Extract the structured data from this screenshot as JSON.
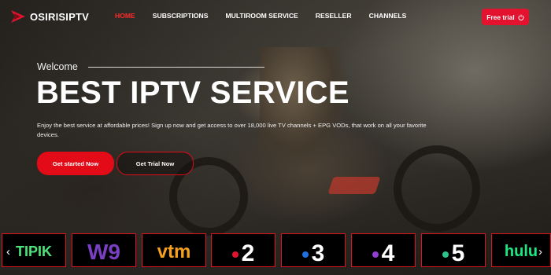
{
  "header": {
    "logo_text": "OSIRISIPTV",
    "nav": [
      {
        "label": "HOME",
        "active": true
      },
      {
        "label": "SUBSCRIPTIONS",
        "active": false
      },
      {
        "label": "MULTIROOM SERVICE",
        "active": false
      },
      {
        "label": "RESELLER",
        "active": false
      },
      {
        "label": "CHANNELS",
        "active": false
      }
    ],
    "cta_label": "Free trial",
    "cta_icon": "power-icon"
  },
  "hero": {
    "welcome": "Welcome",
    "title": "BEST IPTV SERVICE",
    "description": "Enjoy the best service at affordable prices! Sign up now and get access to over 18,000 live TV channels + EPG VODs, that work on all your favorite devices.",
    "primary_button": "Get started Now",
    "secondary_button": "Get Trial Now"
  },
  "channels": {
    "prev_icon": "chevron-left-icon",
    "next_icon": "chevron-right-icon",
    "items": [
      {
        "name": "tipik",
        "label": "TIPIK",
        "color": "#4be37a"
      },
      {
        "name": "w9",
        "label": "W9",
        "color": "#7b3fc4"
      },
      {
        "name": "vtm",
        "label": "vtm",
        "color": "#f4a11e"
      },
      {
        "name": "france-2",
        "label": "2",
        "dot": "#e3132f"
      },
      {
        "name": "france-3",
        "label": "3",
        "dot": "#1f6fe0"
      },
      {
        "name": "france-4",
        "label": "4",
        "dot": "#8e3fd1"
      },
      {
        "name": "france-5",
        "label": "5",
        "dot": "#2cc48a"
      },
      {
        "name": "hulu",
        "label": "hulu",
        "color": "#1ce783"
      }
    ]
  },
  "colors": {
    "accent": "#e3132f",
    "nav_active": "#ff2b2b"
  }
}
